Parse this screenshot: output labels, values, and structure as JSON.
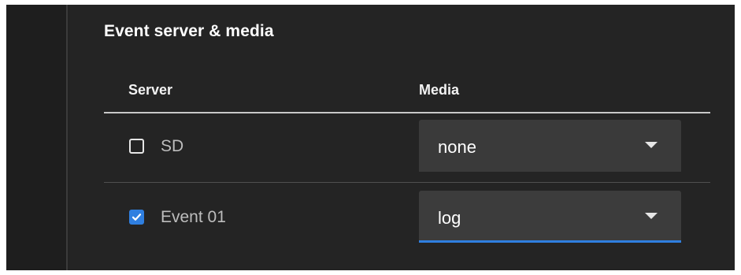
{
  "section": {
    "title": "Event server & media"
  },
  "table": {
    "headers": {
      "server": "Server",
      "media": "Media"
    },
    "rows": [
      {
        "server": "SD",
        "checked": false,
        "media": "none",
        "focused": false
      },
      {
        "server": "Event 01",
        "checked": true,
        "media": "log",
        "focused": true
      }
    ]
  },
  "icons": {
    "checkbox_checked": "checkmark-icon",
    "dropdown": "chevron-down-icon"
  },
  "colors": {
    "accent": "#2f7fe0",
    "background": "#242424",
    "select_bg": "#3a3a3a"
  }
}
